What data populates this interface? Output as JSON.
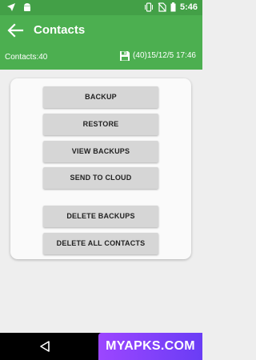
{
  "status_bar": {
    "time": "5:46",
    "icons": [
      "navigation-arrow-icon",
      "android-icon",
      "vibrate-icon",
      "no-sim-icon",
      "battery-icon"
    ]
  },
  "app_bar": {
    "title": "Contacts",
    "back_icon": "arrow-back-icon"
  },
  "info_bar": {
    "contacts_label": "Contacts:40",
    "save_icon": "floppy-disk-icon",
    "last_backup": "(40)15/12/5 17:46"
  },
  "actions": {
    "backup": "BACKUP",
    "restore": "RESTORE",
    "view_backups": "VIEW BACKUPS",
    "send_to_cloud": "SEND TO CLOUD",
    "delete_backups": "DELETE BACKUPS",
    "delete_all_contacts": "DELETE ALL CONTACTS"
  },
  "nav_bar": {
    "back_icon": "triangle-back-icon"
  },
  "watermark": "MYAPKS.COM",
  "colors": {
    "primary": "#4caf50",
    "primary_dark": "#43a047",
    "button": "#d6d6d6",
    "background": "#eeeeee"
  }
}
